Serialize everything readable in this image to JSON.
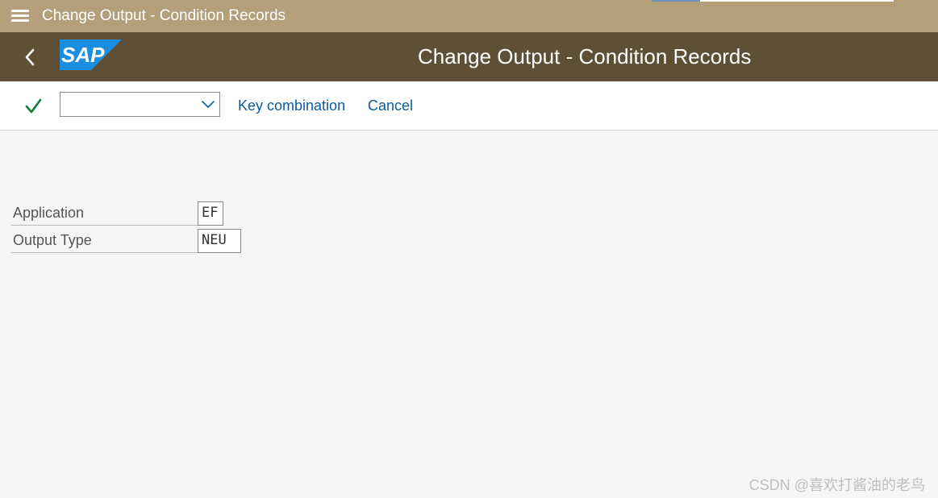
{
  "window": {
    "title": "Change Output - Condition Records"
  },
  "shell": {
    "title": "Change Output - Condition Records",
    "logo_text": "SAP",
    "logo_color": "#1b8ee0"
  },
  "toolbar": {
    "command_field_value": "",
    "key_combination_label": "Key combination",
    "cancel_label": "Cancel",
    "check_color": "#107e3e"
  },
  "form": {
    "fields": [
      {
        "label": "Application",
        "value": "EF"
      },
      {
        "label": "Output Type",
        "value": "NEU"
      }
    ]
  },
  "watermark": "CSDN @喜欢打酱油的老鸟",
  "colors": {
    "title_bar": "#b3a07a",
    "shell_bar": "#5e4f36",
    "link": "#0a5b98",
    "background": "#f6f6f6"
  }
}
